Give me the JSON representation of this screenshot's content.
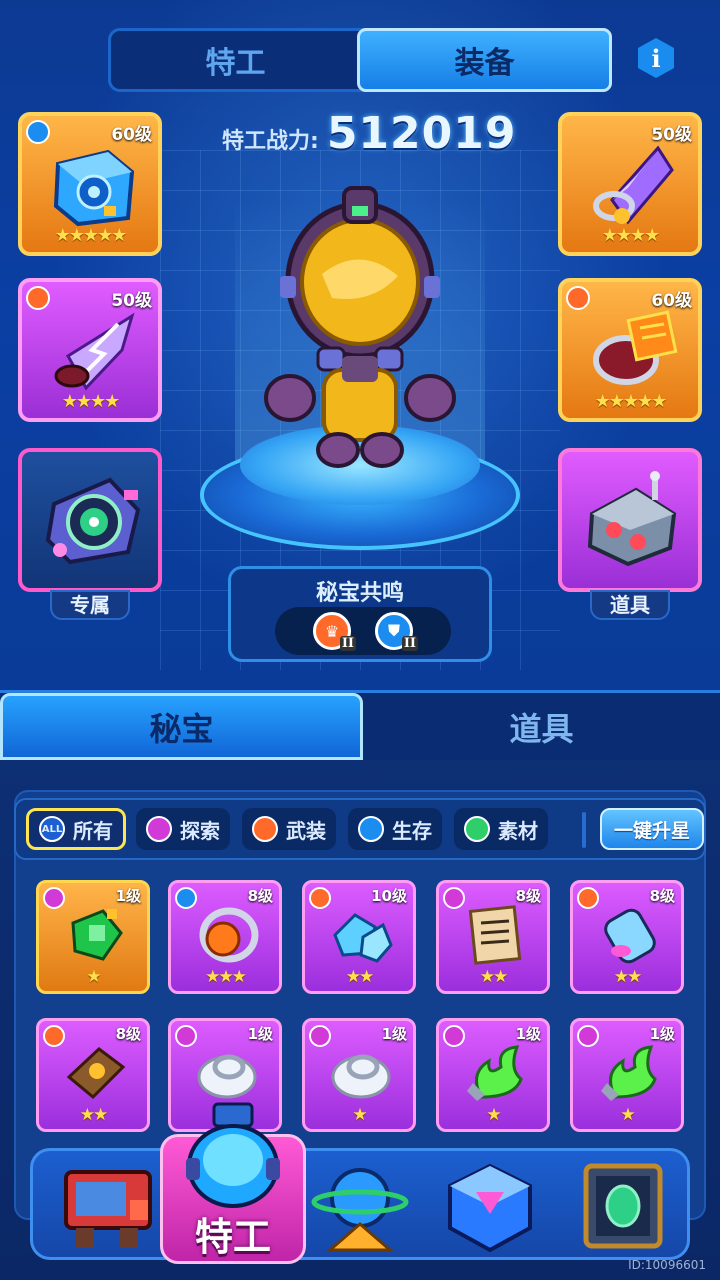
{
  "top_tabs": [
    {
      "label": "特工",
      "active": false
    },
    {
      "label": "装备",
      "active": true
    }
  ],
  "info_icon": "info-icon",
  "power": {
    "label": "特工战力:",
    "value": "512019"
  },
  "slots_left": [
    {
      "level": "60级",
      "stars": "★★★★★",
      "color": "orange",
      "type": "shield-icon"
    },
    {
      "level": "50级",
      "stars": "★★★★",
      "color": "purple",
      "type": "crown-icon"
    },
    {
      "level": "",
      "stars": "",
      "color": "blue",
      "label": "专属"
    }
  ],
  "slots_right": [
    {
      "level": "50级",
      "stars": "★★★★",
      "color": "orange"
    },
    {
      "level": "60级",
      "stars": "★★★★★",
      "color": "orange",
      "type": "crown-icon"
    },
    {
      "level": "",
      "stars": "",
      "color": "purple",
      "label": "道具"
    }
  ],
  "resonance": {
    "title": "秘宝共鸣",
    "badges": [
      {
        "icon": "crown-icon",
        "tier": "II"
      },
      {
        "icon": "shield-icon",
        "tier": "II"
      }
    ]
  },
  "main_tabs": [
    {
      "label": "秘宝",
      "active": true
    },
    {
      "label": "道具",
      "active": false
    }
  ],
  "filters": [
    {
      "icon": "ALL",
      "label": "所有",
      "active": true
    },
    {
      "icon": "explore",
      "label": "探索",
      "active": false
    },
    {
      "icon": "armed",
      "label": "武装",
      "active": false
    },
    {
      "icon": "survive",
      "label": "生存",
      "active": false
    },
    {
      "icon": "material",
      "label": "素材",
      "active": false
    }
  ],
  "upstar_button": "一键升星",
  "items": [
    {
      "level": "1级",
      "stars": "★",
      "color": "orange"
    },
    {
      "level": "8级",
      "stars": "★★★",
      "color": "purple"
    },
    {
      "level": "10级",
      "stars": "★★",
      "color": "purple"
    },
    {
      "level": "8级",
      "stars": "★★",
      "color": "purple"
    },
    {
      "level": "8级",
      "stars": "★★",
      "color": "purple"
    },
    {
      "level": "8级",
      "stars": "★★",
      "color": "purple"
    },
    {
      "level": "1级",
      "stars": "",
      "color": "purple"
    },
    {
      "level": "1级",
      "stars": "★",
      "color": "purple"
    },
    {
      "level": "1级",
      "stars": "★",
      "color": "purple"
    },
    {
      "level": "1级",
      "stars": "★",
      "color": "purple"
    }
  ],
  "nav": {
    "active_label": "特工",
    "user_id": "ID:10096601"
  },
  "colors": {
    "accent": "#1f85ea",
    "gold": "#ffe04a",
    "pink": "#ff5ad6"
  }
}
